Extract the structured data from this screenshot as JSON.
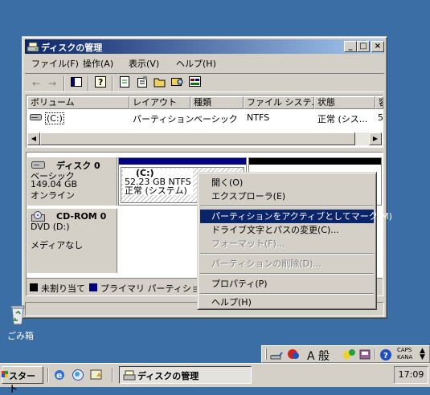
{
  "window": {
    "title": "ディスクの管理",
    "minimize": "_",
    "maximize": "□",
    "close": "×"
  },
  "menu": [
    "ファイル(F)",
    "操作(A)",
    "表示(V)",
    "ヘルプ(H)"
  ],
  "toolbar_icons": [
    "back-icon",
    "forward-icon",
    "properties-pane-icon",
    "help-icon",
    "refresh-icon",
    "properties-icon",
    "open-icon",
    "explore-icon",
    "disk-settings-icon"
  ],
  "volume_list": {
    "columns": [
      "ボリューム",
      "レイアウト",
      "種類",
      "ファイル システ...",
      "状態",
      "容"
    ],
    "rows": [
      {
        "volume": "(C:)",
        "layout": "パーティション",
        "type": "ベーシック",
        "fs": "NTFS",
        "status": "正常 (シス...",
        "capacity": "5"
      }
    ]
  },
  "disks": [
    {
      "name": "ディスク 0",
      "type": "ベーシック",
      "size": "149.04 GB",
      "state": "オンライン",
      "partition": {
        "label": "(C:)",
        "size": "52.23 GB NTFS",
        "status": "正常 (システム)"
      }
    },
    {
      "name": "CD-ROM 0",
      "type": "DVD (D:)",
      "size": "",
      "state": "メディアなし"
    }
  ],
  "legend": [
    {
      "label": "未割り当て",
      "color": "#000000"
    },
    {
      "label": "プライマリ パーティション",
      "color": "#000080"
    }
  ],
  "context_menu": [
    {
      "label": "開く(O)",
      "state": "normal"
    },
    {
      "label": "エクスプローラ(E)",
      "state": "normal"
    },
    {
      "label": "パーティションをアクティブとしてマーク(M)",
      "state": "selected"
    },
    {
      "label": "ドライブ文字とパスの変更(C)...",
      "state": "normal"
    },
    {
      "label": "フォーマット(F)...",
      "state": "disabled"
    },
    {
      "label": "パーティションの削除(D)...",
      "state": "disabled"
    },
    {
      "label": "プロパティ(P)",
      "state": "normal"
    },
    {
      "label": "ヘルプ(H)",
      "state": "normal"
    }
  ],
  "desktop": {
    "recycle_bin": "ごみ箱"
  },
  "ime_bar": {
    "mode": "A 般",
    "caps": "CAPS",
    "kana": "KANA"
  },
  "taskbar": {
    "start": "スタート",
    "task": "ディスクの管理",
    "clock": "17:09"
  },
  "colors": {
    "titlebar": "#0a246a",
    "primary_partition": "#000080",
    "unallocated": "#000000",
    "selection": "#0a246a"
  }
}
